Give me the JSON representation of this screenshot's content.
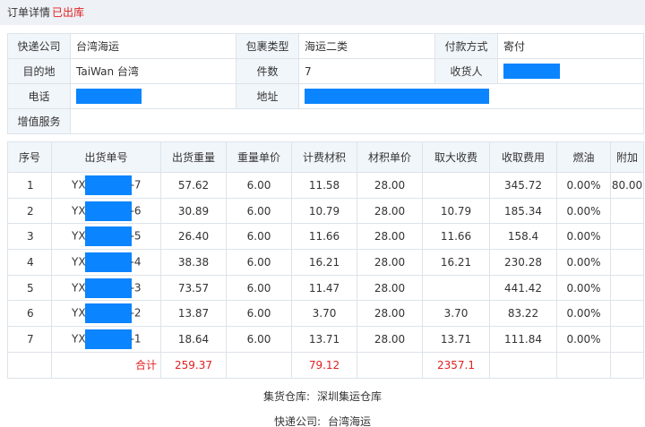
{
  "header": {
    "title": "订单详情",
    "status": "已出库"
  },
  "colors": {
    "accent_red": "#e02020",
    "label_bg": "#f1f6fb",
    "redaction": "#0a84ff",
    "title_bg": "#eef1f5"
  },
  "info": {
    "courier_label": "快递公司",
    "courier_value": "台湾海运",
    "pkg_type_label": "包裹类型",
    "pkg_type_value": "海运二类",
    "pay_label": "付款方式",
    "pay_value": "寄付",
    "dest_label": "目的地",
    "dest_value": "TaiWan 台湾",
    "count_label": "件数",
    "count_value": "7",
    "receiver_label": "收货人",
    "phone_label": "电话",
    "address_label": "地址",
    "vas_label": "增值服务"
  },
  "table": {
    "headers": [
      "序号",
      "出货单号",
      "出货重量",
      "重量单价",
      "计费材积",
      "材积单价",
      "取大收费",
      "收取费用",
      "燃油",
      "附加"
    ],
    "rows": [
      {
        "no": "1",
        "prefix": "YX",
        "suffix": "-7",
        "weight": "57.62",
        "unit_price": "6.00",
        "volume": "11.58",
        "vol_price": "28.00",
        "max_fee": "",
        "fee": "345.72",
        "fuel": "0.00%",
        "extra": "80.00"
      },
      {
        "no": "2",
        "prefix": "YX",
        "suffix": "-6",
        "weight": "30.89",
        "unit_price": "6.00",
        "volume": "10.79",
        "vol_price": "28.00",
        "max_fee": "10.79",
        "fee": "185.34",
        "fuel": "0.00%",
        "extra": ""
      },
      {
        "no": "3",
        "prefix": "YX",
        "suffix": "-5",
        "weight": "26.40",
        "unit_price": "6.00",
        "volume": "11.66",
        "vol_price": "28.00",
        "max_fee": "11.66",
        "fee": "158.4",
        "fuel": "0.00%",
        "extra": ""
      },
      {
        "no": "4",
        "prefix": "YX",
        "suffix": "-4",
        "weight": "38.38",
        "unit_price": "6.00",
        "volume": "16.21",
        "vol_price": "28.00",
        "max_fee": "16.21",
        "fee": "230.28",
        "fuel": "0.00%",
        "extra": ""
      },
      {
        "no": "5",
        "prefix": "YX",
        "suffix": "-3",
        "weight": "73.57",
        "unit_price": "6.00",
        "volume": "11.47",
        "vol_price": "28.00",
        "max_fee": "",
        "fee": "441.42",
        "fuel": "0.00%",
        "extra": ""
      },
      {
        "no": "6",
        "prefix": "YX",
        "suffix": "-2",
        "weight": "13.87",
        "unit_price": "6.00",
        "volume": "3.70",
        "vol_price": "28.00",
        "max_fee": "3.70",
        "fee": "83.22",
        "fuel": "0.00%",
        "extra": ""
      },
      {
        "no": "7",
        "prefix": "YX",
        "suffix": "-1",
        "weight": "18.64",
        "unit_price": "6.00",
        "volume": "13.71",
        "vol_price": "28.00",
        "max_fee": "13.71",
        "fee": "111.84",
        "fuel": "0.00%",
        "extra": ""
      }
    ],
    "total": {
      "label": "合计",
      "weight": "259.37",
      "volume": "79.12",
      "fee": "2357.1"
    }
  },
  "footer": {
    "warehouse_label": "集货仓库:",
    "warehouse_value": "深圳集运仓库",
    "courier_label": "快递公司:",
    "courier_value": "台湾海运"
  }
}
